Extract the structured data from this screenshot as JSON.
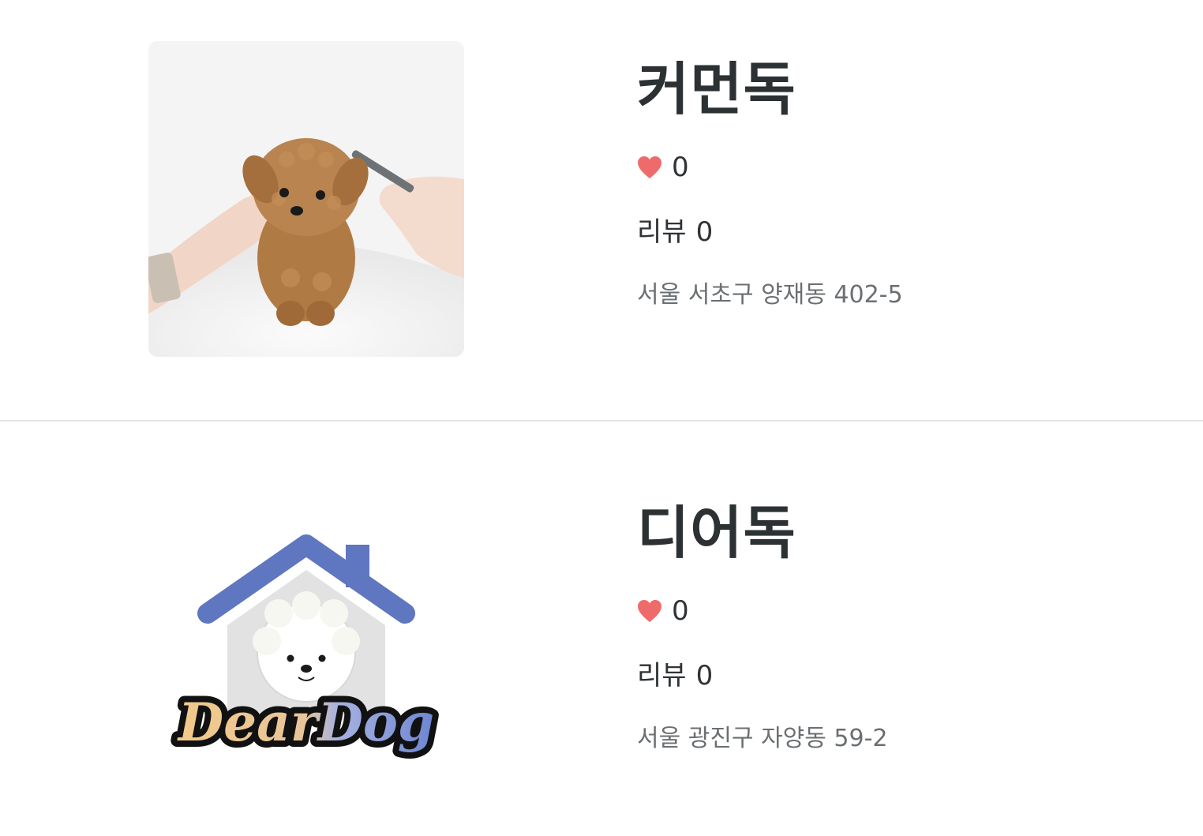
{
  "colors": {
    "heart": "#ef6b6b",
    "divider": "#e6e6e6",
    "title": "#2c3133",
    "address": "#6b6f72",
    "deardog_roof": "#5f76c0",
    "deardog_wall": "#e2e2e2"
  },
  "shops": [
    {
      "name": "커먼독",
      "like_icon": "heart-icon",
      "likes": "0",
      "review_label": "리뷰",
      "reviews": "0",
      "address": "서울 서초구 양재동 402-5",
      "image": "puppy-photo"
    },
    {
      "name": "디어독",
      "like_icon": "heart-icon",
      "likes": "0",
      "review_label": "리뷰",
      "reviews": "0",
      "address": "서울 광진구 자양동 59-2",
      "image": "deardog-logo",
      "logo_text": "DearDog"
    }
  ]
}
